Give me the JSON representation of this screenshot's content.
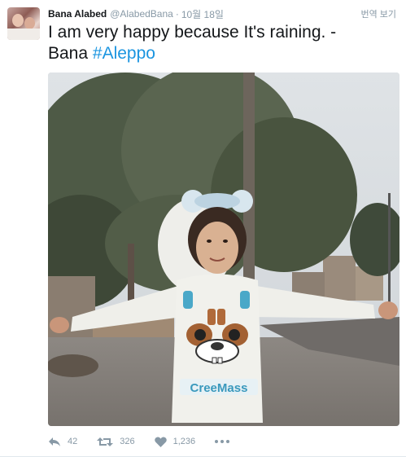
{
  "tweet": {
    "author_name": "Bana Alabed",
    "author_handle": "@AlabedBana",
    "separator": "·",
    "timestamp": "10월 18일",
    "translate_label": "번역 보기",
    "text_line1": "I am very happy because It's raining. -",
    "text_line2_prefix": "Bana ",
    "hashtag": "#Aleppo",
    "sweatshirt_print": "CreeMass",
    "hashtag_color": "#1b95e0"
  },
  "actions": {
    "reply_count": "42",
    "retweet_count": "326",
    "like_count": "1,236",
    "reply_icon": "reply-icon",
    "retweet_icon": "retweet-icon",
    "like_icon": "heart-icon",
    "more_icon": "more-icon"
  },
  "colors": {
    "text_primary": "#14171a",
    "text_secondary": "#8899a6",
    "link": "#1b95e0"
  }
}
